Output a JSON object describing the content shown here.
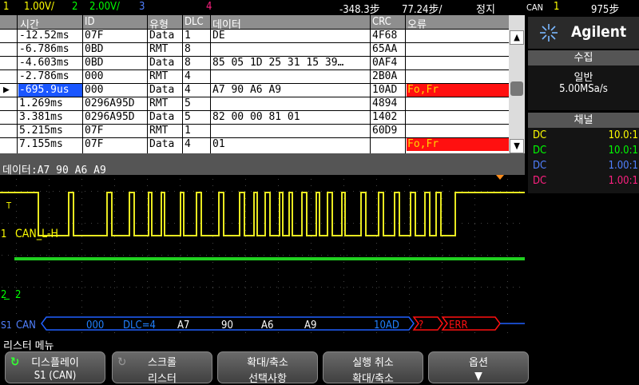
{
  "status": {
    "ch1": "1",
    "ch1_scale": "1.00V/",
    "ch2": "2",
    "ch2_scale": "2.00V/",
    "ch3": "3",
    "ch4": "4",
    "delay": "-348.3步",
    "timebase": "77.24步/",
    "run_state": "정지",
    "trig_src": "CAN",
    "trig_ch": "1",
    "trig_level": "975步"
  },
  "table": {
    "headers": [
      "시간",
      "ID",
      "유형",
      "DLC",
      "데이터",
      "CRC",
      "오류"
    ],
    "rows": [
      {
        "time": "-12.52ms",
        "id": "07F",
        "type": "Data",
        "dlc": "1",
        "data": "DE",
        "crc": "4F68",
        "err": ""
      },
      {
        "time": "-6.786ms",
        "id": "0BD",
        "type": "RMT",
        "dlc": "8",
        "data": "",
        "crc": "65AA",
        "err": ""
      },
      {
        "time": "-4.603ms",
        "id": "0BD",
        "type": "Data",
        "dlc": "8",
        "data": "85 05 1D 25 31 15 39…",
        "crc": "0AF4",
        "err": ""
      },
      {
        "time": "-2.786ms",
        "id": "000",
        "type": "RMT",
        "dlc": "4",
        "data": "",
        "crc": "2B0A",
        "err": ""
      },
      {
        "time": "-695.9us",
        "id": "000",
        "type": "Data",
        "dlc": "4",
        "data": "A7 90 A6 A9",
        "crc": "10AD",
        "err": "Fo,Fr"
      },
      {
        "time": "1.269ms",
        "id": "0296A95D",
        "type": "RMT",
        "dlc": "5",
        "data": "",
        "crc": "4894",
        "err": ""
      },
      {
        "time": "3.381ms",
        "id": "0296A95D",
        "type": "Data",
        "dlc": "5",
        "data": "82 00 00 81 01",
        "crc": "1402",
        "err": ""
      },
      {
        "time": "5.215ms",
        "id": "07F",
        "type": "RMT",
        "dlc": "1",
        "data": "",
        "crc": "60D9",
        "err": ""
      },
      {
        "time": "7.155ms",
        "id": "07F",
        "type": "Data",
        "dlc": "4",
        "data": "01",
        "crc": "",
        "err": "Fo,Fr"
      }
    ],
    "selected_row": 4
  },
  "databar": "데이터:A7 90 A6 A9",
  "scope": {
    "ch1_label": "CAN_L-H",
    "ch1_marker": "1",
    "ch2_marker": "2",
    "trig_marker": "T",
    "bus_marker": "S1",
    "bus_name": "CAN",
    "decode": [
      "000",
      "DLC=4",
      "A7",
      "90",
      "A6",
      "A9",
      "10AD",
      "?",
      "ERR"
    ]
  },
  "right": {
    "logo": "Agilent",
    "acq_title": "수집",
    "acq_mode": "일반",
    "acq_rate": "5.00MSa/s",
    "ch_title": "채널",
    "channels": [
      {
        "coupling": "DC",
        "probe": "10.0:1",
        "color": "#ffff00"
      },
      {
        "coupling": "DC",
        "probe": "10.0:1",
        "color": "#00ff00"
      },
      {
        "coupling": "DC",
        "probe": "1.00:1",
        "color": "#5080ff"
      },
      {
        "coupling": "DC",
        "probe": "1.00:1",
        "color": "#ff2080"
      }
    ]
  },
  "menu": {
    "title": "리스터 메뉴",
    "softkeys": [
      {
        "l1": "디스플레이",
        "l2": "S1 (CAN)"
      },
      {
        "l1": "스크롤",
        "l2": "리스터"
      },
      {
        "l1": "확대/축소",
        "l2": "선택사항"
      },
      {
        "l1": "실행 취소",
        "l2": "확대/축소"
      },
      {
        "l1": "옵션",
        "l2": ""
      }
    ]
  },
  "colors": {
    "ch1": "#e8e820",
    "ch2": "#20d020",
    "bus": "#2060ff",
    "error": "#ff1010"
  }
}
